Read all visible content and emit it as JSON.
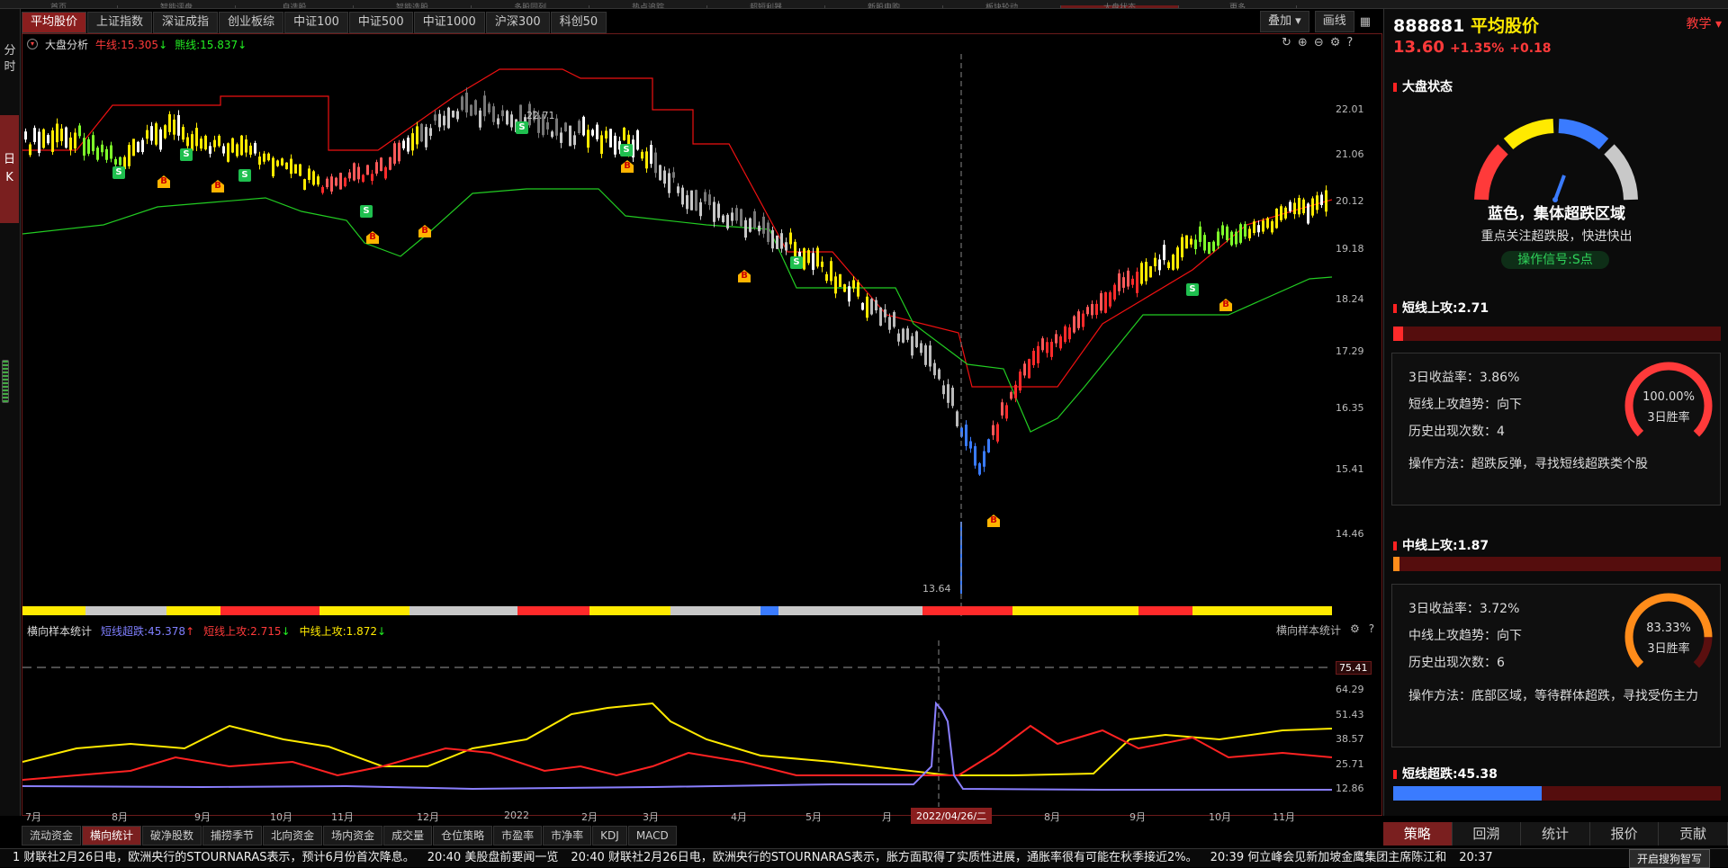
{
  "top_tabs": [
    "首页",
    "智能评盘",
    "自选股",
    "智能选股",
    "多股同列",
    "热点追踪",
    "超短利器",
    "新股申购",
    "板块轮动",
    "大盘状态",
    "更多"
  ],
  "index_tabs": [
    {
      "label": "平均股价",
      "active": true
    },
    {
      "label": "上证指数",
      "active": false
    },
    {
      "label": "深证成指",
      "active": false
    },
    {
      "label": "创业板综",
      "active": false
    },
    {
      "label": "中证100",
      "active": false
    },
    {
      "label": "中证500",
      "active": false
    },
    {
      "label": "中证1000",
      "active": false
    },
    {
      "label": "沪深300",
      "active": false
    },
    {
      "label": "科创50",
      "active": false
    }
  ],
  "left_bar": {
    "intraday": "分时",
    "daily": "日K"
  },
  "tools": {
    "overlay": "叠加",
    "draw": "画线"
  },
  "indicator": {
    "name": "大盘分析",
    "bull_label": "牛线:",
    "bull_value": "15.305",
    "bear_label": "熊线:",
    "bear_value": "15.837"
  },
  "y_axis": [
    "22.01",
    "21.06",
    "20.12",
    "19.18",
    "18.24",
    "17.29",
    "16.35",
    "15.41",
    "14.46"
  ],
  "low_marker": "13.64",
  "top_value": "22.71",
  "lower_panel": {
    "name": "横向样本统计",
    "right_name": "横向样本统计",
    "short_drop_label": "短线超跌:",
    "short_drop_value": "45.378",
    "short_up_label": "短线上攻:",
    "short_up_value": "2.715",
    "mid_up_label": "中线上攻:",
    "mid_up_value": "1.872",
    "y_axis": [
      "75.41",
      "64.29",
      "51.43",
      "38.57",
      "25.71",
      "12.86"
    ]
  },
  "x_axis": [
    "7月",
    "8月",
    "9月",
    "10月",
    "11月",
    "12月",
    "2022",
    "2月",
    "3月",
    "4月",
    "5月",
    "月",
    "8月",
    "9月",
    "10月",
    "11月"
  ],
  "x_cursor_date": "2022/04/26/二",
  "sub_tabs": [
    {
      "label": "流动资金",
      "active": false
    },
    {
      "label": "横向统计",
      "active": true
    },
    {
      "label": "破净股数",
      "active": false
    },
    {
      "label": "捕捞季节",
      "active": false
    },
    {
      "label": "北向资金",
      "active": false
    },
    {
      "label": "场内资金",
      "active": false
    },
    {
      "label": "成交量",
      "active": false
    },
    {
      "label": "仓位策略",
      "active": false
    },
    {
      "label": "市盈率",
      "active": false
    },
    {
      "label": "市净率",
      "active": false
    },
    {
      "label": "KDJ",
      "active": false
    },
    {
      "label": "MACD",
      "active": false
    }
  ],
  "right_panel": {
    "code": "888881",
    "name": "平均股价",
    "teach": "教学",
    "price": "13.60",
    "change_pct": "+1.35%",
    "change": "+0.18",
    "market_state": {
      "title": "大盘状态",
      "status": "蓝色，集体超跌区域",
      "advice": "重点关注超跌股，快进快出",
      "signal": "操作信号:S点"
    },
    "short_up": {
      "title": "短线上攻:2.71",
      "fill": 0.03,
      "return_label": "3日收益率：",
      "return_value": "3.86%",
      "trend_label": "短线上攻趋势：",
      "trend_value": "向下",
      "count_label": "历史出现次数：",
      "count_value": "4",
      "method_label": "操作方法：",
      "method_value": "超跌反弹，寻找短线超跌类个股",
      "winrate": "100.00%",
      "winrate_label": "3日胜率",
      "winrate_fraction": 1.0
    },
    "mid_up": {
      "title": "中线上攻:1.87",
      "fill": 0.02,
      "return_label": "3日收益率：",
      "return_value": "3.72%",
      "trend_label": "中线上攻趋势：",
      "trend_value": "向下",
      "count_label": "历史出现次数：",
      "count_value": "6",
      "method_label": "操作方法：",
      "method_value": "底部区域，等待群体超跌，寻找受伤主力",
      "winrate": "83.33%",
      "winrate_label": "3日胜率",
      "winrate_fraction": 0.8333
    },
    "short_drop": {
      "title": "短线超跌:45.38",
      "fill": 0.4538
    }
  },
  "bottom_tabs": [
    {
      "label": "策略",
      "active": true
    },
    {
      "label": "回溯",
      "active": false
    },
    {
      "label": "统计",
      "active": false
    },
    {
      "label": "报价",
      "active": false
    },
    {
      "label": "贡献",
      "active": false
    }
  ],
  "ticker": [
    "1 财联社2月26日电，欧洲央行的STOURNARAS表示，预计6月份首次降息。",
    "20:40 美股盘前要闻一览",
    "20:40 财联社2月26日电，欧洲央行的STOURNARAS表示，胀方面取得了实质性进展，通胀率很有可能在秋季接近2%。",
    "20:39 何立峰会见新加坡金鹰集团主席陈江和",
    "20:37"
  ],
  "smart_btn": "开启搜狗智写",
  "colors": {
    "accent_red": "#8a1e1e",
    "bull": "#ff3a3a",
    "bear": "#22ee22",
    "blue": "#3a7bff",
    "yellow": "#ffea00",
    "gray": "#c8c8c8"
  }
}
